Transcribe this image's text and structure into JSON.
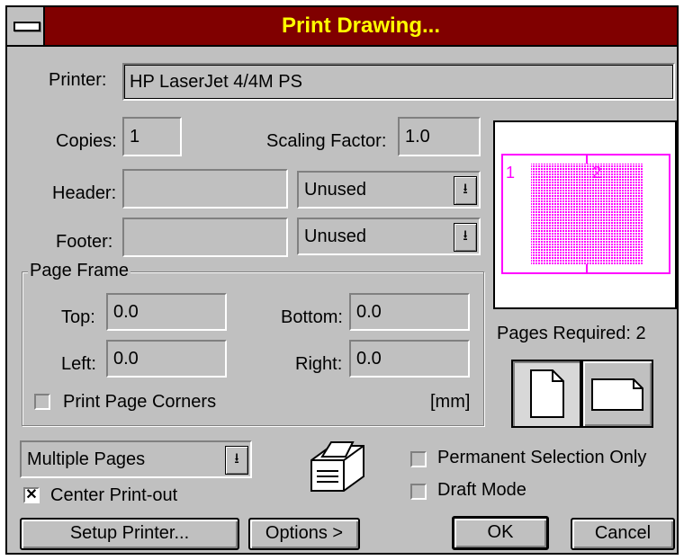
{
  "window": {
    "title": "Print Drawing..."
  },
  "printer": {
    "label": "Printer:",
    "value": "HP LaserJet 4/4M PS"
  },
  "copies": {
    "label": "Copies:",
    "value": "1"
  },
  "scaling": {
    "label": "Scaling Factor:",
    "value": "1.0"
  },
  "header": {
    "label": "Header:",
    "value": "",
    "option": "Unused"
  },
  "footer": {
    "label": "Footer:",
    "value": "",
    "option": "Unused"
  },
  "page_frame": {
    "caption": "Page Frame",
    "top_label": "Top:",
    "top_value": "0.0",
    "bottom_label": "Bottom:",
    "bottom_value": "0.0",
    "left_label": "Left:",
    "left_value": "0.0",
    "right_label": "Right:",
    "right_value": "0.0",
    "corners_label": "Print Page Corners",
    "corners_checked": false,
    "unit": "[mm]"
  },
  "preview": {
    "page1": "1",
    "page2": "2",
    "pages_required": "Pages Required: 2"
  },
  "orientation": {
    "portrait_selected": true
  },
  "mode": {
    "value": "Multiple Pages"
  },
  "center": {
    "label": "Center Print-out",
    "checked": true
  },
  "permanent": {
    "label": "Permanent Selection Only",
    "checked": false
  },
  "draft": {
    "label": "Draft Mode",
    "checked": false
  },
  "buttons": {
    "setup": "Setup Printer...",
    "options": "Options >",
    "ok": "OK",
    "cancel": "Cancel"
  },
  "icons": {
    "dropdown": "dropdown-arrow-icon",
    "printer": "printer-icon",
    "system_menu": "system-menu-icon"
  },
  "colors": {
    "titlebar": "#800000",
    "title_text": "#ffff00",
    "dialog": "#c0c0c0",
    "preview_pages": "#ff00ff"
  }
}
